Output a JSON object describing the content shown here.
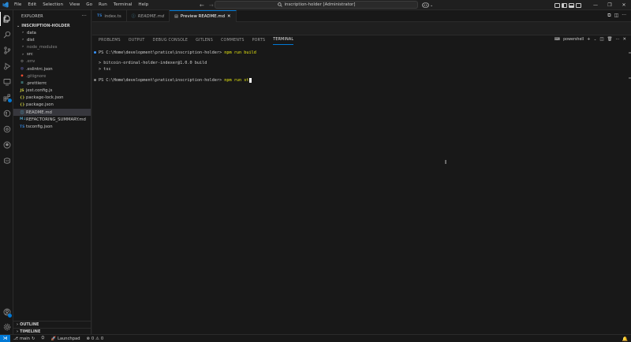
{
  "menu": [
    "File",
    "Edit",
    "Selection",
    "View",
    "Go",
    "Run",
    "Terminal",
    "Help"
  ],
  "command_center": {
    "text": "inscription-holder [Administrator]"
  },
  "sidebar": {
    "title": "EXPLORER",
    "root": "INSCRIPTION-HOLDER",
    "items": [
      {
        "label": "data",
        "kind": "folder",
        "icon": "chevron-right-icon",
        "color": "#cccccc"
      },
      {
        "label": "dist",
        "kind": "folder",
        "icon": "chevron-right-icon",
        "color": "#cccccc"
      },
      {
        "label": "node_modules",
        "kind": "folder",
        "icon": "chevron-right-icon",
        "color": "#8b8b8b"
      },
      {
        "label": "src",
        "kind": "folder",
        "icon": "chevron-right-icon",
        "color": "#cccccc"
      },
      {
        "label": ".env",
        "kind": "file",
        "icon": "gear-icon",
        "color": "#8b8b8b"
      },
      {
        "label": ".eslintrc.json",
        "kind": "file",
        "icon": "eslint-icon",
        "color": "#cccccc"
      },
      {
        "label": ".gitignore",
        "kind": "file",
        "icon": "git-icon",
        "color": "#8b8b8b"
      },
      {
        "label": ".prettierrc",
        "kind": "file",
        "icon": "prettier-icon",
        "color": "#cccccc"
      },
      {
        "label": "jest.config.js",
        "kind": "file",
        "icon": "js-icon",
        "color": "#cccccc"
      },
      {
        "label": "package-lock.json",
        "kind": "file",
        "icon": "json-icon",
        "color": "#cccccc"
      },
      {
        "label": "package.json",
        "kind": "file",
        "icon": "json-icon",
        "color": "#cccccc"
      },
      {
        "label": "README.md",
        "kind": "file",
        "icon": "info-icon",
        "color": "#cccccc",
        "selected": true
      },
      {
        "label": "REFACTORING_SUMMARY.md",
        "kind": "file",
        "icon": "markdown-icon",
        "color": "#cccccc"
      },
      {
        "label": "tsconfig.json",
        "kind": "file",
        "icon": "tsconfig-icon",
        "color": "#cccccc"
      }
    ],
    "outline_label": "OUTLINE",
    "timeline_label": "TIMELINE"
  },
  "tabs": [
    {
      "label": "index.ts",
      "icon": "ts-icon",
      "active": false
    },
    {
      "label": "README.md",
      "icon": "info-icon",
      "active": false,
      "italic": true
    },
    {
      "label": "Preview README.md",
      "icon": "preview-icon",
      "active": true
    }
  ],
  "panel": {
    "tabs": [
      "PROBLEMS",
      "OUTPUT",
      "DEBUG CONSOLE",
      "GITLENS",
      "COMMENTS",
      "PORTS",
      "TERMINAL"
    ],
    "active_tab": "TERMINAL",
    "shell_label": "powershell",
    "terminal": {
      "line1_prompt": "PS C:\\Home\\development\\pratice\\inscription-holder> ",
      "line1_cmd": "npm run build",
      "line2": "> bitcoin-ordinal-holder-indexer@1.0.0 build",
      "line3": "> tsc",
      "line4_prompt": "PS C:\\Home\\development\\pratice\\inscription-holder> ",
      "line4_cmd": "npm run st"
    }
  },
  "statusbar": {
    "branch": "main",
    "launchpad": "Launchpad",
    "errors": "0",
    "warnings": "0"
  },
  "colors": {
    "accent": "#0078d4",
    "terminal_cmd": "#e5e510",
    "success_dot": "#3794ff",
    "prompt_dot": "#8b8b8b"
  }
}
